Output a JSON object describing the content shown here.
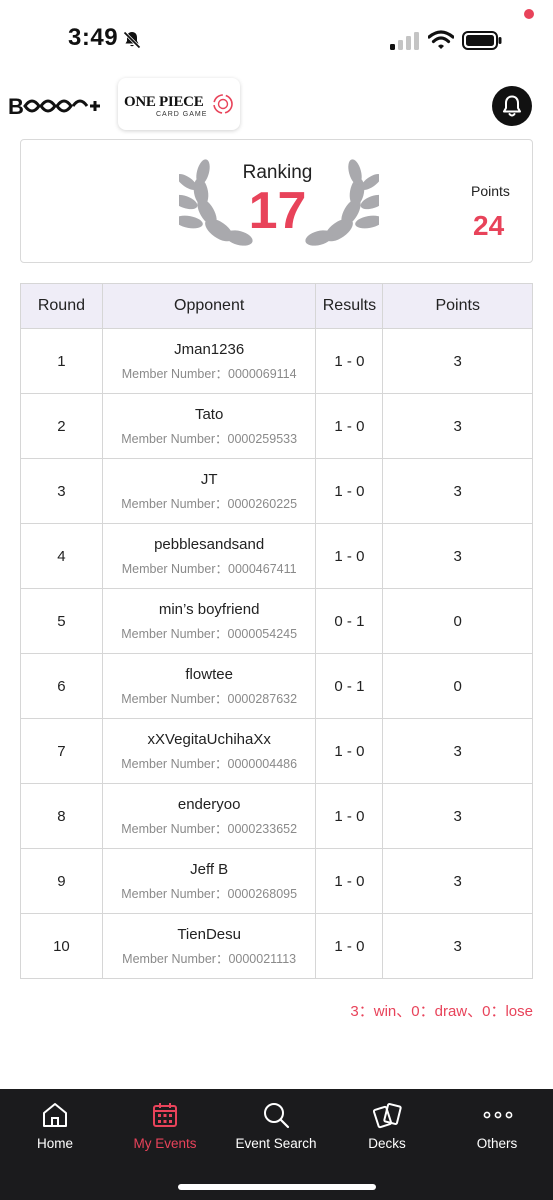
{
  "status_bar": {
    "time": "3:49",
    "icons": [
      "bell-slash-icon",
      "signal-icon",
      "wifi-icon",
      "battery-icon"
    ]
  },
  "header": {
    "brand_logo": "BNEX+",
    "game_logo_title": "ONE PIECE",
    "game_logo_subtitle": "CARD GAME",
    "notification_icon": "bell-icon"
  },
  "ranking": {
    "label": "Ranking",
    "value": "17",
    "points_label": "Points",
    "points_value": "24"
  },
  "table": {
    "headers": {
      "round": "Round",
      "opponent": "Opponent",
      "results": "Results",
      "points": "Points"
    },
    "rows": [
      {
        "round": "1",
        "name": "Jman1236",
        "member": "Member Number：0000069114",
        "result": "1 - 0",
        "points": "3"
      },
      {
        "round": "2",
        "name": "Tato",
        "member": "Member Number：0000259533",
        "result": "1 - 0",
        "points": "3"
      },
      {
        "round": "3",
        "name": "JT",
        "member": "Member Number：0000260225",
        "result": "1 - 0",
        "points": "3"
      },
      {
        "round": "4",
        "name": "pebblesandsand",
        "member": "Member Number：0000467411",
        "result": "1 - 0",
        "points": "3"
      },
      {
        "round": "5",
        "name": "min’s boyfriend",
        "member": "Member Number：0000054245",
        "result": "0 - 1",
        "points": "0"
      },
      {
        "round": "6",
        "name": "flowtee",
        "member": "Member Number：0000287632",
        "result": "0 - 1",
        "points": "0"
      },
      {
        "round": "7",
        "name": "xXVegitaUchihaXx",
        "member": "Member Number：0000004486",
        "result": "1 - 0",
        "points": "3"
      },
      {
        "round": "8",
        "name": "enderyoo",
        "member": "Member Number：0000233652",
        "result": "1 - 0",
        "points": "3"
      },
      {
        "round": "9",
        "name": "Jeff B",
        "member": "Member Number：0000268095",
        "result": "1 - 0",
        "points": "3"
      },
      {
        "round": "10",
        "name": "TienDesu",
        "member": "Member Number：0000021113",
        "result": "1 - 0",
        "points": "3"
      }
    ]
  },
  "legend": "3：win、0：draw、0：lose",
  "nav": {
    "items": [
      {
        "label": "Home",
        "icon": "home-icon"
      },
      {
        "label": "My Events",
        "icon": "calendar-icon",
        "active": true
      },
      {
        "label": "Event Search",
        "icon": "search-icon"
      },
      {
        "label": "Decks",
        "icon": "cards-icon"
      },
      {
        "label": "Others",
        "icon": "more-icon"
      }
    ]
  },
  "colors": {
    "accent": "#e8435a",
    "nav_background": "#1b1b1d",
    "table_header_bg": "#efedf7"
  }
}
